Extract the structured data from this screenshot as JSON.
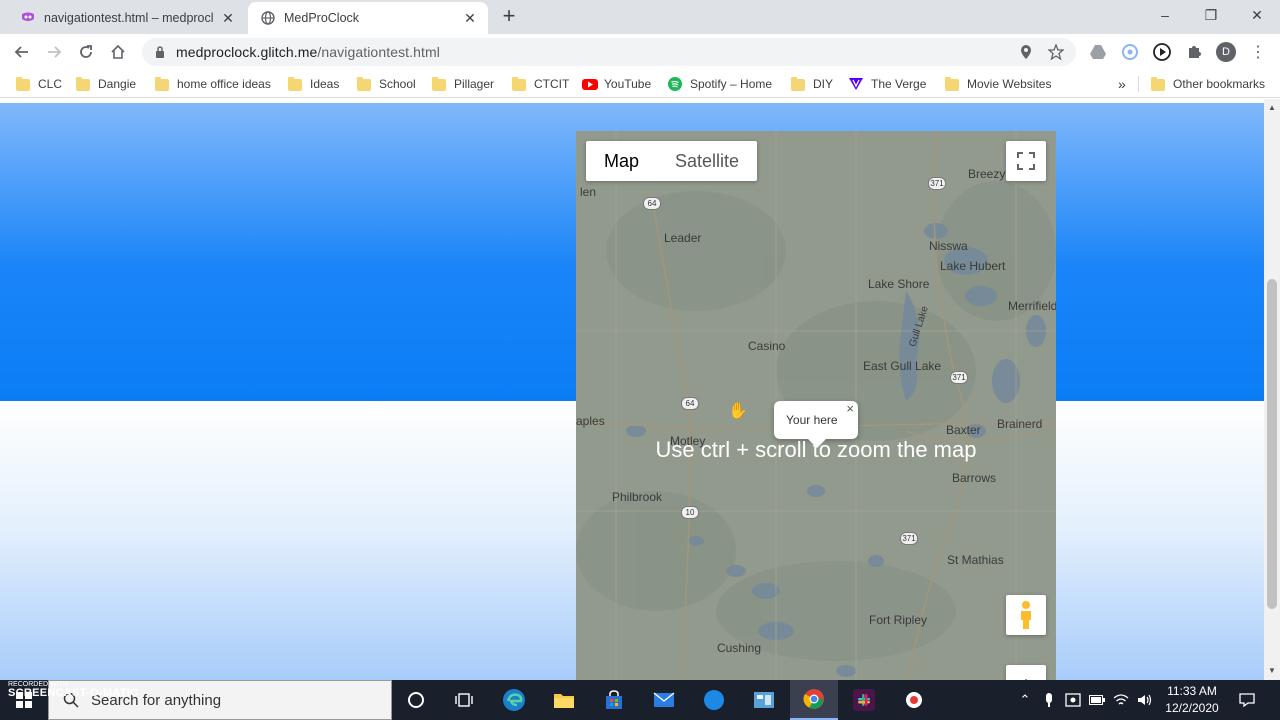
{
  "browser": {
    "tabs": [
      {
        "title": "navigationtest.html – medproclock",
        "active": false,
        "icon": "glitch-icon"
      },
      {
        "title": "MedProClock",
        "active": true,
        "icon": "globe-icon"
      }
    ],
    "new_tab": "+",
    "window_controls": {
      "minimize": "–",
      "restore": "❐",
      "close": "✕"
    },
    "url_domain": "medproclock.glitch.me",
    "url_path": "/navigationtest.html",
    "profile_initial": "D"
  },
  "bookmarks": [
    {
      "label": "CLC",
      "icon": "folder-icon"
    },
    {
      "label": "Dangie",
      "icon": "folder-icon"
    },
    {
      "label": "home office ideas",
      "icon": "folder-icon"
    },
    {
      "label": "Ideas",
      "icon": "folder-icon"
    },
    {
      "label": "School",
      "icon": "folder-icon"
    },
    {
      "label": "Pillager",
      "icon": "folder-icon"
    },
    {
      "label": "CTCIT",
      "icon": "folder-icon"
    },
    {
      "label": "YouTube",
      "icon": "youtube-icon"
    },
    {
      "label": "Spotify – Home",
      "icon": "spotify-icon"
    },
    {
      "label": "DIY",
      "icon": "folder-icon"
    },
    {
      "label": "The Verge",
      "icon": "verge-icon"
    },
    {
      "label": "Movie Websites",
      "icon": "folder-icon"
    }
  ],
  "bookmarks_overflow": "»",
  "other_bookmarks": "Other bookmarks",
  "map": {
    "type_buttons": {
      "map": "Map",
      "satellite": "Satellite"
    },
    "selected_type": "Map",
    "places": [
      "Breezy",
      "len",
      "Leader",
      "Nisswa",
      "Lake Hubert",
      "Lake Shore",
      "Merrifield",
      "Gull Lake",
      "Casino",
      "East Gull Lake",
      "Baxter",
      "Brainerd",
      "aples",
      "Motley",
      "Barrows",
      "Philbrook",
      "St Mathias",
      "Fort Ripley",
      "Cushing"
    ],
    "routes": [
      "371",
      "64",
      "64",
      "371",
      "10",
      "371"
    ],
    "info_window": "Your here",
    "info_close": "×",
    "zoom_message": "Use ctrl + scroll to zoom the map"
  },
  "taskbar": {
    "search_placeholder": "Search for anything",
    "watermark_line1": "RECORDED WITH",
    "watermark_line2": "SCREENCAST-O-MATIC",
    "time": "11:33 AM",
    "date": "12/2/2020"
  },
  "colors": {
    "hero_top": "#80b8fb",
    "hero_bottom": "#0a7df6",
    "tab_strip": "#dee1e6",
    "taskbar": "#1a1f2c"
  }
}
